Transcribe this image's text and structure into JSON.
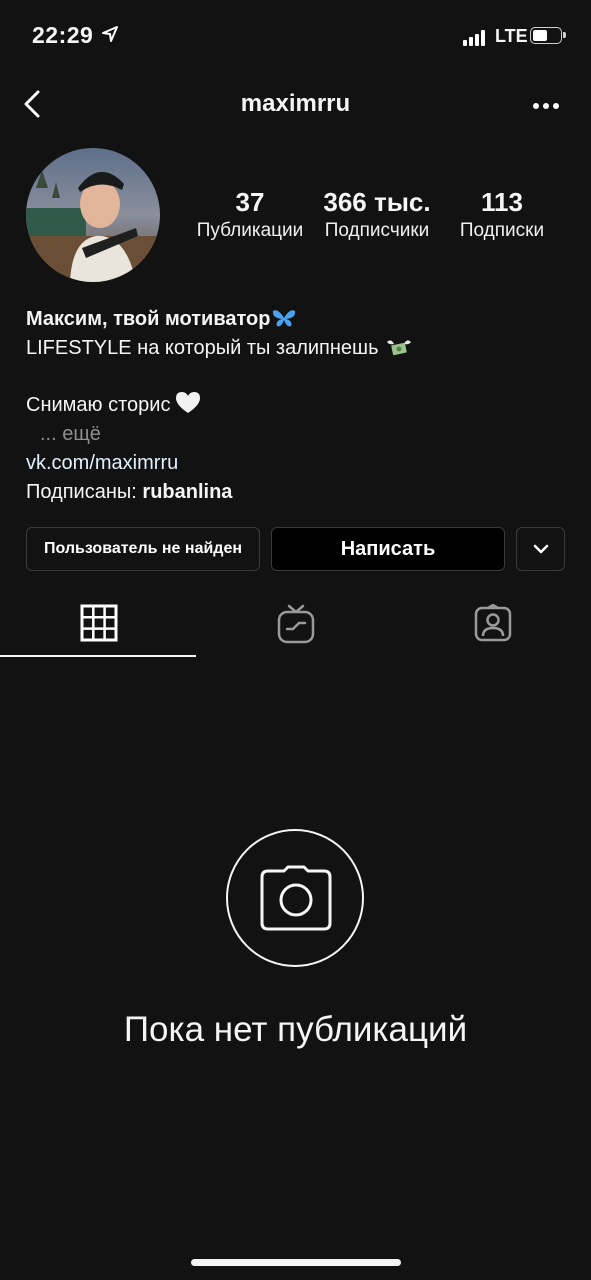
{
  "status_bar": {
    "time": "22:29",
    "network": "LTE",
    "battery_level": 0.45
  },
  "header": {
    "username": "maximrru",
    "back_icon": "chevron-left-icon",
    "more_icon": "more-horizontal-icon"
  },
  "profile": {
    "stats": [
      {
        "value": "37",
        "label": "Публикации"
      },
      {
        "value": "366 тыс.",
        "label": "Подписчики"
      },
      {
        "value": "113",
        "label": "Подписки"
      }
    ]
  },
  "bio": {
    "name": "Максим, твой мотиватор",
    "line1": "LIFESTYLE на который ты залипнешь",
    "line2": "Снимаю сторис",
    "more": "... ещё",
    "link": "vk.com/maximrru",
    "followed_prefix": "Подписаны:",
    "followed_user": "rubanlina"
  },
  "buttons": {
    "user_not_found": "Пользователь не найден",
    "message": "Написать"
  },
  "tabs": [
    {
      "name": "grid",
      "icon": "grid-icon",
      "active": true
    },
    {
      "name": "igtv",
      "icon": "igtv-icon",
      "active": false
    },
    {
      "name": "tagged",
      "icon": "tagged-person-icon",
      "active": false
    }
  ],
  "empty_state": {
    "icon": "camera-icon",
    "text": "Пока нет публикаций"
  },
  "colors": {
    "background": "#121212",
    "text": "#f5f5f5",
    "muted": "#8e8e8e",
    "border": "#3a3a3a",
    "link": "#e0f1ff"
  }
}
